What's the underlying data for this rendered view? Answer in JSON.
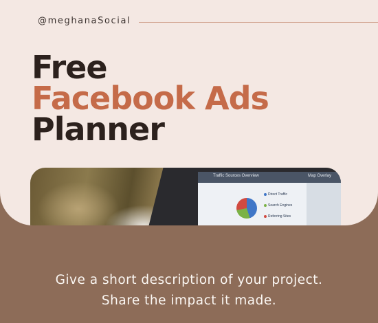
{
  "header": {
    "handle": "@meghanaSocial"
  },
  "title": {
    "line1": "Free",
    "line2": "Facebook Ads",
    "line3": "Planner"
  },
  "screen": {
    "left_panel_title": "Traffic Sources Overview",
    "right_panel_title": "Map Overlay",
    "legend": [
      {
        "label": "Direct Traffic",
        "color": "#3f76c7"
      },
      {
        "label": "Search Engines",
        "color": "#7bb246"
      },
      {
        "label": "Referring Sites",
        "color": "#d14a40"
      }
    ]
  },
  "description": {
    "line1": "Give a short description of your project.",
    "line2": "Share the impact it made."
  },
  "colors": {
    "background_top": "#f4e8e3",
    "background_bottom": "#8d6c58",
    "accent": "#c56b49",
    "title_dark": "#2c211d"
  }
}
